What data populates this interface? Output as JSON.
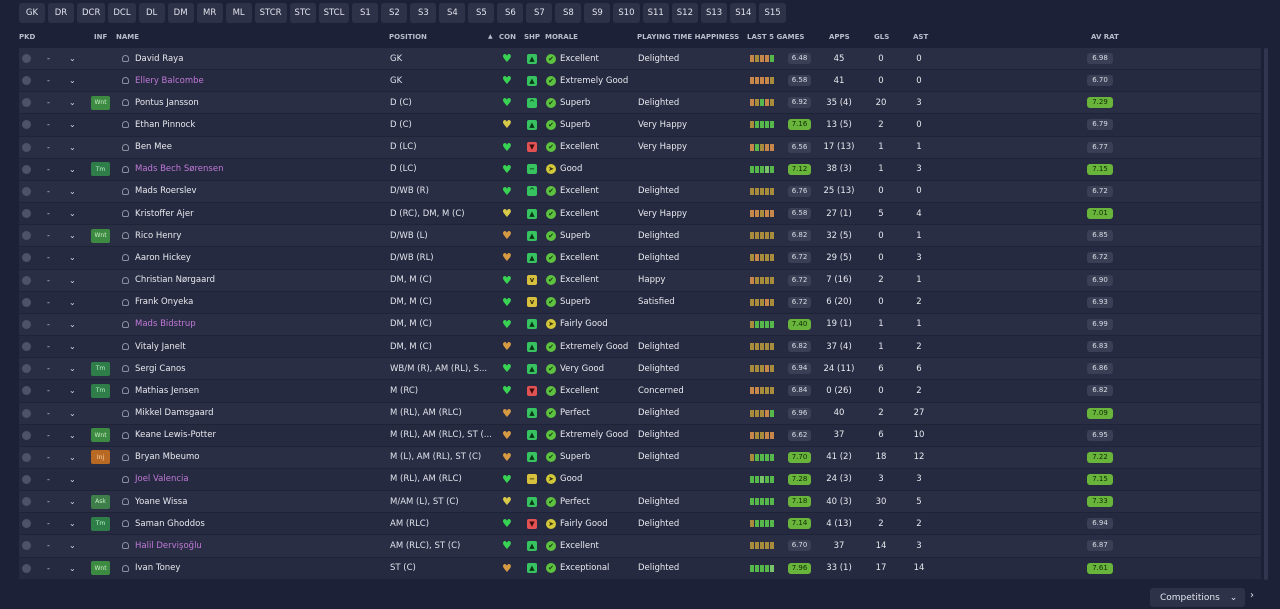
{
  "position_filters": [
    "GK",
    "DR",
    "DCR",
    "DCL",
    "DL",
    "DM",
    "MR",
    "ML",
    "STCR",
    "STC",
    "STCL",
    "S1",
    "S2",
    "S3",
    "S4",
    "S5",
    "S6",
    "S7",
    "S8",
    "S9",
    "S10",
    "S11",
    "S12",
    "S13",
    "S14",
    "S15"
  ],
  "columns": {
    "pkd": "PKD",
    "inf": "INF",
    "name": "NAME",
    "position": "POSITION",
    "sort_arrow": "▲",
    "con": "CON",
    "shp": "SHP",
    "morale": "MORALE",
    "playing_time": "PLAYING TIME HAPPINESS",
    "last5": "LAST 5 GAMES",
    "apps": "APPS",
    "gls": "GLS",
    "ast": "AST",
    "avrat": "AV RAT"
  },
  "icons": {
    "dash": "-",
    "chevron": "⌄",
    "heart": "♥",
    "morale_tick": "✔",
    "morale_arrow": "➤"
  },
  "colors": {
    "background": "#1d2137",
    "row": "#2a2e45",
    "loan_name": "#c079d8",
    "good_rating": "#69b43a",
    "heart_green": "#39d353",
    "heart_yellow": "#d8c94a",
    "heart_orange": "#d69a43"
  },
  "players": [
    {
      "name": "David Raya",
      "loan": false,
      "inf": "",
      "position": "GK",
      "con": "green",
      "shp": "grn",
      "shp_icon": "▲",
      "morale_icon": "tick",
      "morale": "Excellent",
      "happy": "Delighted",
      "form": [
        "o",
        "y",
        "o",
        "o",
        "g"
      ],
      "rating": "6.48",
      "rating_hi": false,
      "apps": "45",
      "gls": "0",
      "ast": "0",
      "avrat": "6.98",
      "avrat_hi": false
    },
    {
      "name": "Ellery Balcombe",
      "loan": true,
      "inf": "",
      "position": "GK",
      "con": "green",
      "shp": "grn",
      "shp_icon": "▲",
      "morale_icon": "tick",
      "morale": "Extremely Good",
      "happy": "",
      "form": [
        "o",
        "o",
        "o",
        "o",
        "y"
      ],
      "rating": "6.58",
      "rating_hi": false,
      "apps": "41",
      "gls": "0",
      "ast": "0",
      "avrat": "6.70",
      "avrat_hi": false
    },
    {
      "name": "Pontus Jansson",
      "loan": false,
      "inf": "Wnt",
      "inf_type": "wnt",
      "position": "D (C)",
      "con": "green",
      "shp": "grn",
      "shp_icon": "^",
      "morale_icon": "tick",
      "morale": "Superb",
      "happy": "Delighted",
      "form": [
        "o",
        "y",
        "g",
        "o",
        "y"
      ],
      "rating": "6.92",
      "rating_hi": false,
      "apps": "35 (4)",
      "gls": "20",
      "ast": "3",
      "avrat": "7.29",
      "avrat_hi": true
    },
    {
      "name": "Ethan Pinnock",
      "loan": false,
      "inf": "",
      "position": "D (C)",
      "con": "yellow",
      "shp": "grn",
      "shp_icon": "▲",
      "morale_icon": "tick",
      "morale": "Superb",
      "happy": "Very Happy",
      "form": [
        "y",
        "g",
        "g",
        "g",
        "g"
      ],
      "rating": "7.16",
      "rating_hi": true,
      "apps": "13 (5)",
      "gls": "2",
      "ast": "0",
      "avrat": "6.79",
      "avrat_hi": false
    },
    {
      "name": "Ben Mee",
      "loan": false,
      "inf": "",
      "position": "D (LC)",
      "con": "green",
      "shp": "red",
      "shp_icon": "▼",
      "morale_icon": "tick",
      "morale": "Excellent",
      "happy": "Very Happy",
      "form": [
        "o",
        "g",
        "y",
        "o",
        "o"
      ],
      "rating": "6.56",
      "rating_hi": false,
      "apps": "17 (13)",
      "gls": "1",
      "ast": "1",
      "avrat": "6.77",
      "avrat_hi": false
    },
    {
      "name": "Mads Bech Sørensen",
      "loan": true,
      "inf": "Tm",
      "inf_type": "tm",
      "position": "D (LC)",
      "con": "green",
      "shp": "grn",
      "shp_icon": "−",
      "morale_icon": "y",
      "morale": "Good",
      "happy": "",
      "form": [
        "g",
        "g",
        "g",
        "lg",
        "g"
      ],
      "rating": "7.12",
      "rating_hi": true,
      "apps": "38 (3)",
      "gls": "1",
      "ast": "3",
      "avrat": "7.15",
      "avrat_hi": true
    },
    {
      "name": "Mads Roerslev",
      "loan": false,
      "inf": "",
      "position": "D/WB (R)",
      "con": "green",
      "shp": "grn",
      "shp_icon": "^",
      "morale_icon": "tick",
      "morale": "Excellent",
      "happy": "Delighted",
      "form": [
        "y",
        "y",
        "y",
        "y",
        "y"
      ],
      "rating": "6.76",
      "rating_hi": false,
      "apps": "25 (13)",
      "gls": "0",
      "ast": "0",
      "avrat": "6.72",
      "avrat_hi": false
    },
    {
      "name": "Kristoffer Ajer",
      "loan": false,
      "inf": "",
      "position": "D (RC), DM, M (C)",
      "con": "yellow",
      "shp": "grn",
      "shp_icon": "▲",
      "morale_icon": "tick",
      "morale": "Excellent",
      "happy": "Very Happy",
      "form": [
        "o",
        "o",
        "y",
        "o",
        "o"
      ],
      "rating": "6.58",
      "rating_hi": false,
      "apps": "27 (1)",
      "gls": "5",
      "ast": "4",
      "avrat": "7.01",
      "avrat_hi": true
    },
    {
      "name": "Rico Henry",
      "loan": false,
      "inf": "Wnt",
      "inf_type": "wnt",
      "position": "D/WB (L)",
      "con": "orange",
      "shp": "grn",
      "shp_icon": "▲",
      "morale_icon": "tick",
      "morale": "Superb",
      "happy": "Delighted",
      "form": [
        "y",
        "y",
        "y",
        "y",
        "y"
      ],
      "rating": "6.82",
      "rating_hi": false,
      "apps": "32 (5)",
      "gls": "0",
      "ast": "1",
      "avrat": "6.85",
      "avrat_hi": false
    },
    {
      "name": "Aaron Hickey",
      "loan": false,
      "inf": "",
      "position": "D/WB (RL)",
      "con": "orange",
      "shp": "grn",
      "shp_icon": "▲",
      "morale_icon": "tick",
      "morale": "Excellent",
      "happy": "Delighted",
      "form": [
        "y",
        "o",
        "y",
        "y",
        "y"
      ],
      "rating": "6.72",
      "rating_hi": false,
      "apps": "29 (5)",
      "gls": "0",
      "ast": "3",
      "avrat": "6.72",
      "avrat_hi": false
    },
    {
      "name": "Christian Nørgaard",
      "loan": false,
      "inf": "",
      "position": "DM, M (C)",
      "con": "green",
      "shp": "yel",
      "shp_icon": "v",
      "morale_icon": "tick",
      "morale": "Excellent",
      "happy": "Happy",
      "form": [
        "o",
        "y",
        "y",
        "y",
        "y"
      ],
      "rating": "6.72",
      "rating_hi": false,
      "apps": "7 (16)",
      "gls": "2",
      "ast": "1",
      "avrat": "6.90",
      "avrat_hi": false
    },
    {
      "name": "Frank Onyeka",
      "loan": false,
      "inf": "",
      "position": "DM, M (C)",
      "con": "green",
      "shp": "yel",
      "shp_icon": "v",
      "morale_icon": "tick",
      "morale": "Superb",
      "happy": "Satisfied",
      "form": [
        "y",
        "y",
        "y",
        "o",
        "y"
      ],
      "rating": "6.72",
      "rating_hi": false,
      "apps": "6 (20)",
      "gls": "0",
      "ast": "2",
      "avrat": "6.93",
      "avrat_hi": false
    },
    {
      "name": "Mads Bidstrup",
      "loan": true,
      "inf": "",
      "position": "DM, M (C)",
      "con": "green",
      "shp": "grn",
      "shp_icon": "▲",
      "morale_icon": "y",
      "morale": "Fairly Good",
      "happy": "",
      "form": [
        "y",
        "g",
        "g",
        "g",
        "g"
      ],
      "rating": "7.40",
      "rating_hi": true,
      "apps": "19 (1)",
      "gls": "1",
      "ast": "1",
      "avrat": "6.99",
      "avrat_hi": false
    },
    {
      "name": "Vitaly Janelt",
      "loan": false,
      "inf": "",
      "position": "DM, M (C)",
      "con": "orange",
      "shp": "grn",
      "shp_icon": "▲",
      "morale_icon": "tick",
      "morale": "Extremely Good",
      "happy": "Delighted",
      "form": [
        "y",
        "y",
        "y",
        "y",
        "y"
      ],
      "rating": "6.82",
      "rating_hi": false,
      "apps": "37 (4)",
      "gls": "1",
      "ast": "2",
      "avrat": "6.83",
      "avrat_hi": false
    },
    {
      "name": "Sergi Canos",
      "loan": false,
      "inf": "Tm",
      "inf_type": "tm",
      "position": "WB/M (R), AM (RL), S...",
      "con": "green",
      "shp": "grn",
      "shp_icon": "▲",
      "morale_icon": "tick",
      "morale": "Very Good",
      "happy": "Delighted",
      "form": [
        "y",
        "y",
        "y",
        "o",
        "y"
      ],
      "rating": "6.94",
      "rating_hi": false,
      "apps": "24 (11)",
      "gls": "6",
      "ast": "6",
      "avrat": "6.86",
      "avrat_hi": false
    },
    {
      "name": "Mathias Jensen",
      "loan": false,
      "inf": "Tm",
      "inf_type": "tm",
      "position": "M (RC)",
      "con": "green",
      "shp": "red",
      "shp_icon": "▼",
      "morale_icon": "tick",
      "morale": "Excellent",
      "happy": "Concerned",
      "form": [
        "o",
        "o",
        "y",
        "y",
        "y"
      ],
      "rating": "6.84",
      "rating_hi": false,
      "apps": "0 (26)",
      "gls": "0",
      "ast": "2",
      "avrat": "6.82",
      "avrat_hi": false
    },
    {
      "name": "Mikkel Damsgaard",
      "loan": false,
      "inf": "",
      "position": "M (RL), AM (RLC)",
      "con": "orange",
      "shp": "grn",
      "shp_icon": "▲",
      "morale_icon": "tick",
      "morale": "Perfect",
      "happy": "Delighted",
      "form": [
        "y",
        "y",
        "y",
        "o",
        "g"
      ],
      "rating": "6.96",
      "rating_hi": false,
      "apps": "40",
      "gls": "2",
      "ast": "27",
      "avrat": "7.09",
      "avrat_hi": true
    },
    {
      "name": "Keane Lewis-Potter",
      "loan": false,
      "inf": "Wnt",
      "inf_type": "wnt",
      "position": "M (RL), AM (RLC), ST (...",
      "con": "orange",
      "shp": "grn",
      "shp_icon": "▲",
      "morale_icon": "tick",
      "morale": "Extremely Good",
      "happy": "Delighted",
      "form": [
        "o",
        "y",
        "y",
        "o",
        "o"
      ],
      "rating": "6.62",
      "rating_hi": false,
      "apps": "37",
      "gls": "6",
      "ast": "10",
      "avrat": "6.95",
      "avrat_hi": false
    },
    {
      "name": "Bryan Mbeumo",
      "loan": false,
      "inf": "Inj",
      "inf_type": "inj",
      "position": "M (L), AM (RL), ST (C)",
      "con": "orange",
      "shp": "grn",
      "shp_icon": "▲",
      "morale_icon": "tick",
      "morale": "Superb",
      "happy": "Delighted",
      "form": [
        "y",
        "g",
        "g",
        "g",
        "g"
      ],
      "rating": "7.70",
      "rating_hi": true,
      "apps": "41 (2)",
      "gls": "18",
      "ast": "12",
      "avrat": "7.22",
      "avrat_hi": true
    },
    {
      "name": "Joel Valencia",
      "loan": true,
      "inf": "",
      "position": "M (RL), AM (RLC)",
      "con": "green",
      "shp": "yel",
      "shp_icon": "−",
      "morale_icon": "y",
      "morale": "Good",
      "happy": "",
      "form": [
        "g",
        "g",
        "lg",
        "g",
        "g"
      ],
      "rating": "7.28",
      "rating_hi": true,
      "apps": "24 (3)",
      "gls": "3",
      "ast": "3",
      "avrat": "7.15",
      "avrat_hi": true
    },
    {
      "name": "Yoane Wissa",
      "loan": false,
      "inf": "Ask",
      "inf_type": "ask",
      "position": "M/AM (L), ST (C)",
      "con": "yellow",
      "shp": "grn",
      "shp_icon": "▲",
      "morale_icon": "tick",
      "morale": "Perfect",
      "happy": "Delighted",
      "form": [
        "g",
        "g",
        "g",
        "g",
        "g"
      ],
      "rating": "7.18",
      "rating_hi": true,
      "apps": "40 (3)",
      "gls": "30",
      "ast": "5",
      "avrat": "7.33",
      "avrat_hi": true
    },
    {
      "name": "Saman Ghoddos",
      "loan": false,
      "inf": "Tm",
      "inf_type": "tm",
      "position": "AM (RLC)",
      "con": "green",
      "shp": "red",
      "shp_icon": "▼",
      "morale_icon": "y",
      "morale": "Fairly Good",
      "happy": "Delighted",
      "form": [
        "y",
        "g",
        "g",
        "g",
        "g"
      ],
      "rating": "7.14",
      "rating_hi": true,
      "apps": "4 (13)",
      "gls": "2",
      "ast": "2",
      "avrat": "6.94",
      "avrat_hi": false
    },
    {
      "name": "Halil Dervişoğlu",
      "loan": true,
      "inf": "",
      "position": "AM (RLC), ST (C)",
      "con": "green",
      "shp": "grn",
      "shp_icon": "▲",
      "morale_icon": "tick",
      "morale": "Excellent",
      "happy": "",
      "form": [
        "y",
        "y",
        "y",
        "y",
        "y"
      ],
      "rating": "6.70",
      "rating_hi": false,
      "apps": "37",
      "gls": "14",
      "ast": "3",
      "avrat": "6.87",
      "avrat_hi": false
    },
    {
      "name": "Ivan Toney",
      "loan": false,
      "inf": "Wnt",
      "inf_type": "wnt",
      "position": "ST (C)",
      "con": "orange",
      "shp": "grn",
      "shp_icon": "▲",
      "morale_icon": "tick",
      "morale": "Exceptional",
      "happy": "Delighted",
      "form": [
        "g",
        "g",
        "g",
        "g",
        "lg"
      ],
      "rating": "7.96",
      "rating_hi": true,
      "apps": "33 (1)",
      "gls": "17",
      "ast": "14",
      "avrat": "7.61",
      "avrat_hi": true
    }
  ],
  "footer": {
    "competitions_label": "Competitions",
    "competitions_chevron": "⌄",
    "next_arrow": "›"
  }
}
